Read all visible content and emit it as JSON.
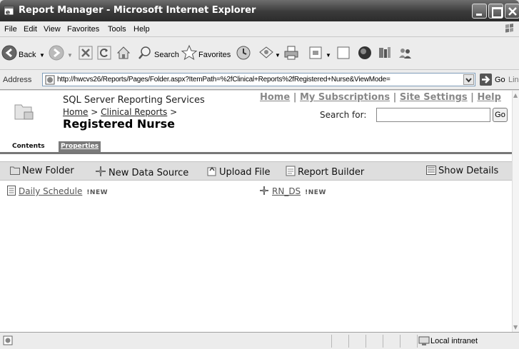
{
  "window": {
    "title": "Report Manager - Microsoft Internet Explorer"
  },
  "menu": {
    "items": [
      "File",
      "Edit",
      "View",
      "Favorites",
      "Tools",
      "Help"
    ]
  },
  "toolbar": {
    "back_label": "Back",
    "search_label": "Search",
    "favorites_label": "Favorites"
  },
  "address": {
    "label": "Address",
    "url": "http://hwcvs26/Reports/Pages/Folder.aspx?ItemPath=%2fClinical+Reports%2fRegistered+Nurse&ViewMode=",
    "go_label": "Go",
    "links_label": "Links"
  },
  "header": {
    "app_name": "SQL Server Reporting Services",
    "breadcrumb": {
      "home": "Home",
      "sep": ">",
      "parent": "Clinical Reports"
    },
    "title": "Registered Nurse",
    "links": {
      "home": "Home",
      "subscriptions": "My Subscriptions",
      "settings": "Site Settings",
      "help": "Help",
      "sep": "|"
    },
    "search_label": "Search for:",
    "search_value": "",
    "search_go": "Go"
  },
  "tabs": {
    "contents": "Contents",
    "properties": "Properties"
  },
  "actions": {
    "new_folder": "New Folder",
    "new_data_source": "New Data Source",
    "upload_file": "Upload File",
    "report_builder": "Report Builder",
    "show_details": "Show Details"
  },
  "items": [
    {
      "name": "Daily Schedule",
      "badge": "!NEW",
      "icon": "report-icon"
    },
    {
      "name": "RN_DS",
      "badge": "!NEW",
      "icon": "data-source-icon"
    }
  ],
  "status": {
    "zone": "Local intranet"
  }
}
